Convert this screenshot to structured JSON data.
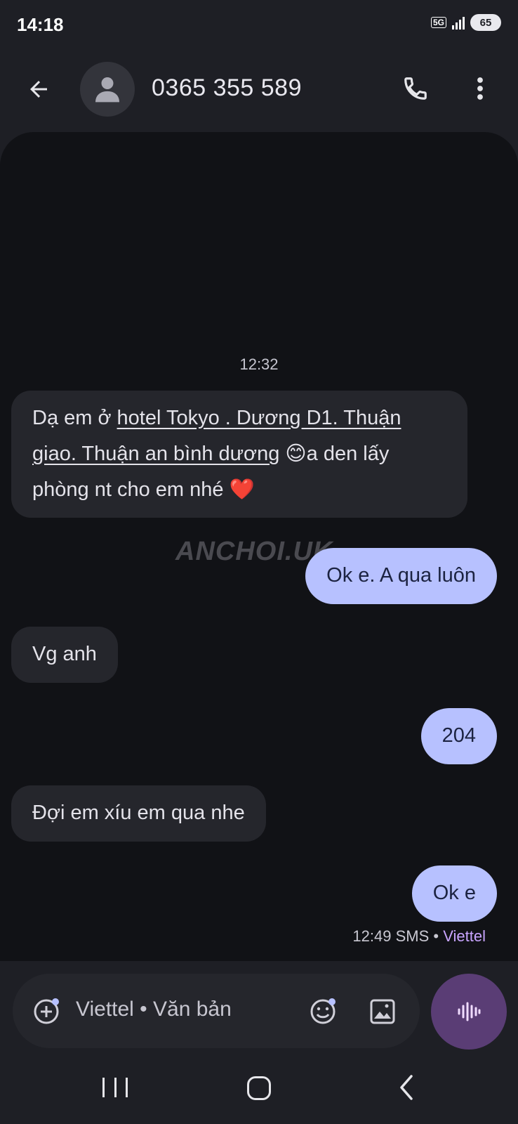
{
  "status_bar": {
    "time": "14:18",
    "network": "5G",
    "battery": "65"
  },
  "header": {
    "contact": "0365 355 589"
  },
  "conversation": {
    "time_label": "12:32",
    "messages": [
      {
        "direction": "incoming",
        "link_text": "hotel Tokyo . Dương D1. Thuận giao. Thuận an bình dương",
        "prefix": "Dạ em ở ",
        "emoji1": "😊",
        "suffix": "a den lấy phòng nt cho em nhé ",
        "emoji2": "❤️"
      },
      {
        "direction": "outgoing",
        "text": "Ok e. A qua luôn"
      },
      {
        "direction": "incoming",
        "text": "Vg anh"
      },
      {
        "direction": "outgoing",
        "text": "204"
      },
      {
        "direction": "incoming",
        "text": "Đợi em xíu em qua nhe"
      },
      {
        "direction": "outgoing",
        "text": "Ok e"
      }
    ],
    "meta": {
      "time": "12:49",
      "type": "SMS",
      "separator": "•",
      "carrier": "Viettel"
    },
    "watermark": "ANCHOI.UK"
  },
  "compose": {
    "placeholder": "Viettel • Văn bản"
  },
  "icons": {
    "back": "arrow-left-icon",
    "avatar": "person-icon",
    "call": "phone-icon",
    "more": "more-vert-icon",
    "add": "add-circle-icon",
    "emoji": "emoji-icon",
    "image": "image-icon",
    "voice": "waveform-icon"
  },
  "colors": {
    "background": "#1e1f25",
    "conversation_bg": "#111216",
    "incoming_bubble": "#25262c",
    "outgoing_bubble": "#b7c1ff",
    "voice_button": "#5a3d75",
    "carrier": "#c9a5ff"
  }
}
